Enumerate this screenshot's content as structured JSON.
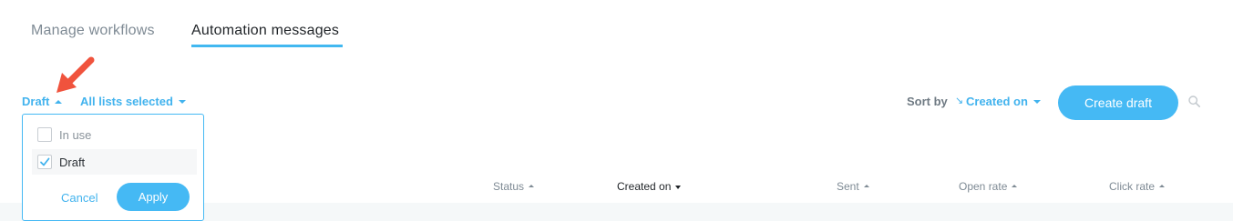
{
  "tabs": [
    {
      "label": "Manage workflows",
      "active": false
    },
    {
      "label": "Automation messages",
      "active": true
    }
  ],
  "filters": {
    "status_label": "Draft",
    "lists_label": "All lists selected"
  },
  "sort": {
    "label": "Sort by",
    "direction_icon": "↘",
    "field": "Created on"
  },
  "actions": {
    "create_label": "Create draft",
    "search_icon": "search-icon"
  },
  "dropdown": {
    "options": [
      {
        "label": "In use",
        "checked": false
      },
      {
        "label": "Draft",
        "checked": true
      }
    ],
    "cancel_label": "Cancel",
    "apply_label": "Apply"
  },
  "table": {
    "columns": [
      {
        "label": "Status",
        "sort": "asc"
      },
      {
        "label": "Created on",
        "sort": "desc",
        "active": true
      },
      {
        "label": "Sent",
        "sort": "asc"
      },
      {
        "label": "Open rate",
        "sort": "asc"
      },
      {
        "label": "Click rate",
        "sort": "asc"
      }
    ]
  },
  "colors": {
    "accent": "#45b9f4",
    "annotation_arrow": "#f0533d"
  }
}
